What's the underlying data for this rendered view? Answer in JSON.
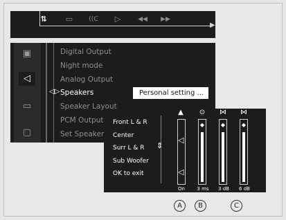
{
  "toolbar": {
    "icons": [
      {
        "name": "audio-setup-icon",
        "glyph": "⇅",
        "active": true
      },
      {
        "name": "subtitle-icon",
        "glyph": "▭",
        "active": false
      },
      {
        "name": "audio-wave-icon",
        "glyph": "((ᑕ",
        "active": false
      },
      {
        "name": "play-icon",
        "glyph": "▷",
        "active": false
      },
      {
        "name": "rewind-icon",
        "glyph": "◀◀",
        "active": false
      },
      {
        "name": "forward-icon",
        "glyph": "▶▶",
        "active": false
      }
    ]
  },
  "sidebar": {
    "categories": [
      {
        "name": "picture-category-icon",
        "glyph": "▣"
      },
      {
        "name": "audio-category-icon",
        "glyph": "◁"
      },
      {
        "name": "language-category-icon",
        "glyph": "▭"
      },
      {
        "name": "features-category-icon",
        "glyph": "▢"
      }
    ]
  },
  "menu": {
    "items": [
      "Digital Output",
      "Night mode",
      "Analog Output",
      "Speakers",
      "Speaker Layout",
      "PCM Output",
      "Set Speaker"
    ],
    "selected_index": 3,
    "setting_value": "Personal setting ...",
    "pointer_glyph": "◁▷"
  },
  "overlay": {
    "items": [
      "Front L & R",
      "Center",
      "Surr L & R",
      "Sub Woofer",
      "OK to exit"
    ],
    "columns": [
      {
        "icon": "▲",
        "label": "On"
      },
      {
        "icon": "⊙",
        "label": "3 ms"
      },
      {
        "icon": "⋈",
        "label": "3 dB"
      },
      {
        "icon": "⋈",
        "label": "6 dB"
      }
    ]
  },
  "callouts": [
    "A",
    "B",
    "C"
  ],
  "colors": {
    "panel": "#1c1c1c",
    "background": "#e8e8e8",
    "text": "#ffffff",
    "dim_text": "#8e8e8e"
  }
}
